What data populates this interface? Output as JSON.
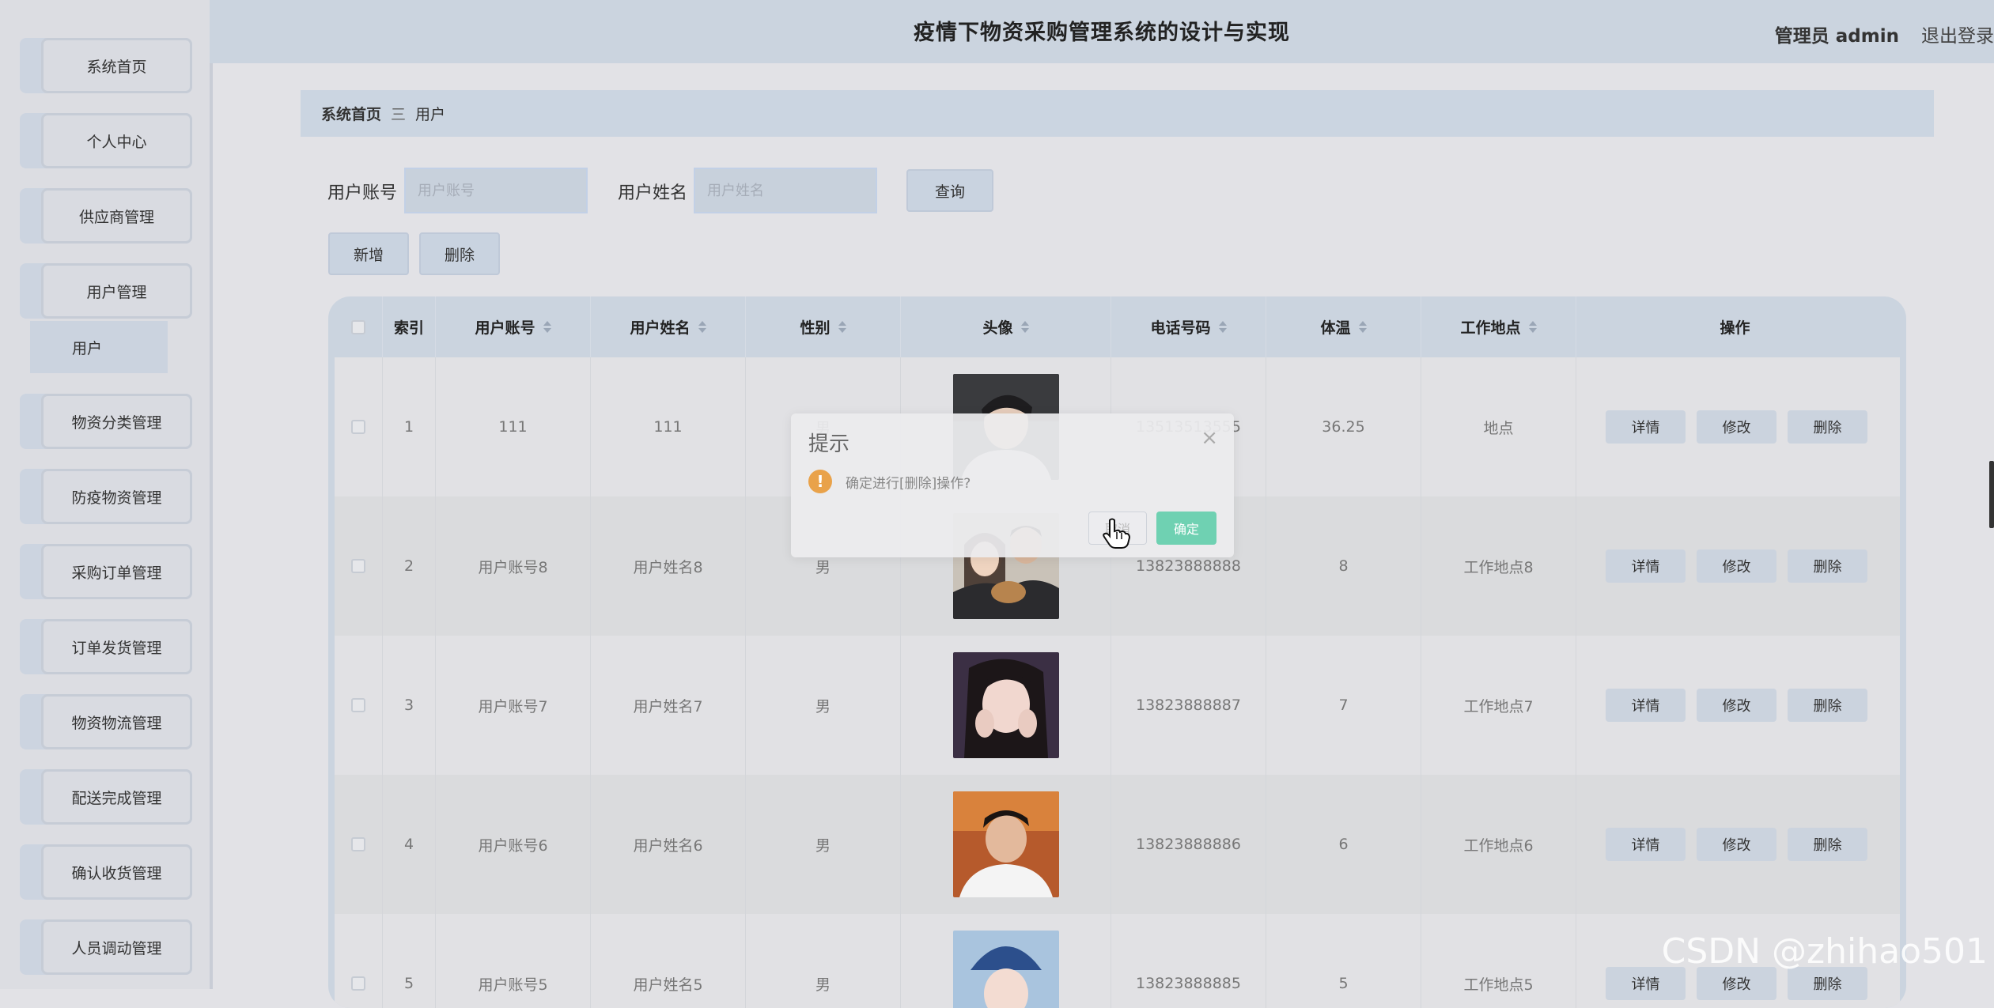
{
  "header": {
    "title": "疫情下物资采购管理系统的设计与实现",
    "user": "管理员 admin",
    "logout": "退出登录"
  },
  "sidebar": {
    "items": [
      {
        "label": "系统首页"
      },
      {
        "label": "个人中心"
      },
      {
        "label": "供应商管理"
      },
      {
        "label": "用户管理"
      },
      {
        "label": "物资分类管理"
      },
      {
        "label": "防疫物资管理"
      },
      {
        "label": "采购订单管理"
      },
      {
        "label": "订单发货管理"
      },
      {
        "label": "物资物流管理"
      },
      {
        "label": "配送完成管理"
      },
      {
        "label": "确认收货管理"
      },
      {
        "label": "人员调动管理"
      }
    ],
    "subitem": "用户"
  },
  "breadcrumb": {
    "home": "系统首页",
    "separator": "三",
    "current": "用户"
  },
  "search": {
    "account_label": "用户账号",
    "account_placeholder": "用户账号",
    "name_label": "用户姓名",
    "name_placeholder": "用户姓名",
    "query_button": "查询"
  },
  "toolbar": {
    "add_label": "新增",
    "delete_label": "删除"
  },
  "table": {
    "columns": [
      "索引",
      "用户账号",
      "用户姓名",
      "性别",
      "头像",
      "电话号码",
      "体温",
      "工作地点",
      "操作"
    ],
    "rows": [
      {
        "index": "1",
        "account": "111",
        "name": "111",
        "gender": "男",
        "phone": "13513513555",
        "temp": "36.25",
        "location": "地点"
      },
      {
        "index": "2",
        "account": "用户账号8",
        "name": "用户姓名8",
        "gender": "男",
        "phone": "13823888888",
        "temp": "8",
        "location": "工作地点8"
      },
      {
        "index": "3",
        "account": "用户账号7",
        "name": "用户姓名7",
        "gender": "男",
        "phone": "13823888887",
        "temp": "7",
        "location": "工作地点7"
      },
      {
        "index": "4",
        "account": "用户账号6",
        "name": "用户姓名6",
        "gender": "男",
        "phone": "13823888886",
        "temp": "6",
        "location": "工作地点6"
      },
      {
        "index": "5",
        "account": "用户账号5",
        "name": "用户姓名5",
        "gender": "男",
        "phone": "13823888885",
        "temp": "5",
        "location": "工作地点5"
      }
    ],
    "actions": {
      "detail": "详情",
      "edit": "修改",
      "delete": "删除"
    }
  },
  "dialog": {
    "title": "提示",
    "message": "确定进行[删除]操作?",
    "cancel": "取消",
    "confirm": "确定"
  },
  "watermark": "CSDN @zhihao501"
}
